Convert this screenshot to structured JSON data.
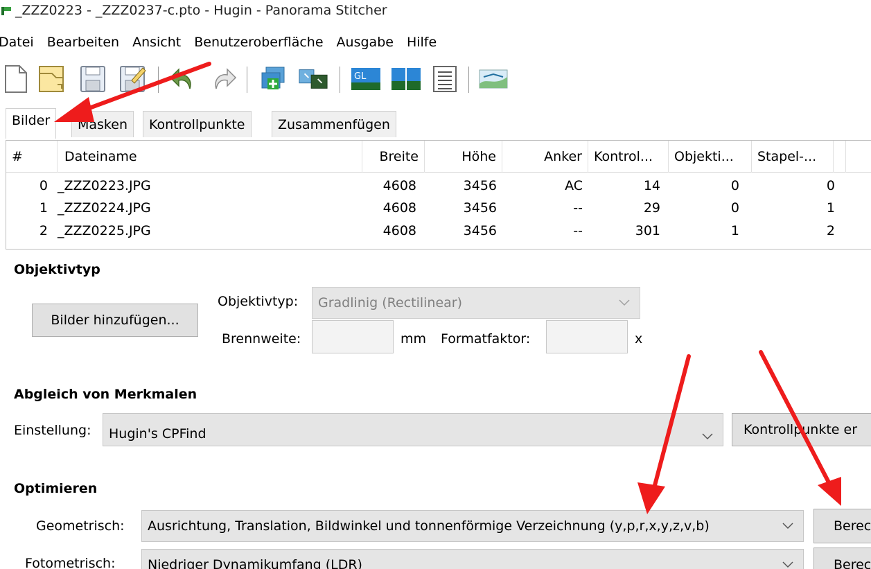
{
  "window": {
    "title": "_ZZZ0223 - _ZZZ0237-c.pto - Hugin - Panorama Stitcher"
  },
  "menu": [
    "Datei",
    "Bearbeiten",
    "Ansicht",
    "Benutzeroberfläche",
    "Ausgabe",
    "Hilfe"
  ],
  "toolbar": {
    "icons": [
      "new-file-icon",
      "open-file-icon",
      "save-icon",
      "save-as-icon",
      "undo-icon",
      "redo-icon",
      "add-images-icon",
      "create-control-points-icon",
      "gl-preview-icon",
      "fast-preview-icon",
      "layout-icon",
      "stitch-panorama-icon"
    ]
  },
  "tabs": [
    "Bilder",
    "Masken",
    "Kontrollpunkte",
    "Zusammenfügen"
  ],
  "image_table": {
    "columns": [
      "#",
      "Dateiname",
      "Breite",
      "Höhe",
      "Anker",
      "Kontrol...",
      "Objekti...",
      "Stapel-..."
    ],
    "rows": [
      [
        "0",
        "_ZZZ0223.JPG",
        "4608",
        "3456",
        "AC",
        "14",
        "0",
        "0"
      ],
      [
        "1",
        "_ZZZ0224.JPG",
        "4608",
        "3456",
        "--",
        "29",
        "0",
        "1"
      ],
      [
        "2",
        "_ZZZ0225.JPG",
        "4608",
        "3456",
        "--",
        "301",
        "1",
        "2"
      ]
    ]
  },
  "lens_section": {
    "heading": "Objektivtyp",
    "add_images_button": "Bilder hinzufügen...",
    "lens_type_label": "Objektivtyp:",
    "lens_type_value": "Gradlinig (Rectilinear)",
    "focal_length_label": "Brennweite:",
    "focal_length_value": "",
    "focal_length_unit": "mm",
    "crop_factor_label": "Formatfaktor:",
    "crop_factor_value": "",
    "crop_factor_unit": "x"
  },
  "feature_matching": {
    "heading": "Abgleich von Merkmalen",
    "setting_label": "Einstellung:",
    "setting_value": "Hugin's CPFind",
    "create_cp_button": "Kontrollpunkte er"
  },
  "optimize": {
    "heading": "Optimieren",
    "geometric_label": "Geometrisch:",
    "geometric_value": "Ausrichtung, Translation, Bildwinkel und tonnenförmige Verzeichnung (y,p,r,x,y,z,v,b)",
    "geometric_button": "Berec",
    "photometric_label": "Fotometrisch:",
    "photometric_value": "Niedriger Dynamikumfang (LDR)",
    "photometric_button": "Berec"
  },
  "colors": {
    "annotation_arrow": "#ee1c1c",
    "button_bg": "#e1e1e1",
    "combo_bg": "#e5e5e5"
  }
}
